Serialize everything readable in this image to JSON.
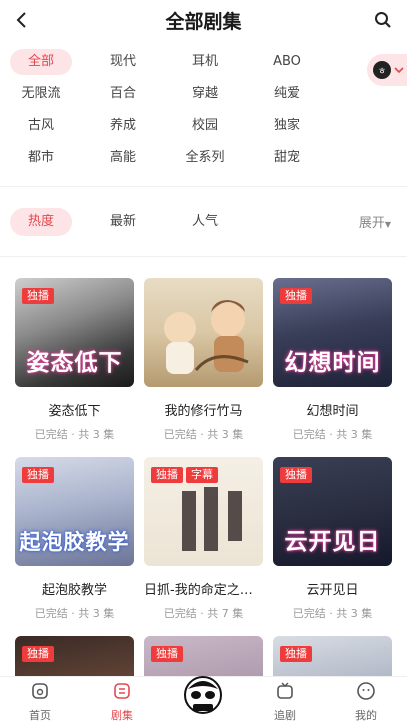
{
  "header": {
    "title": "全部剧集",
    "back_icon": "chevron-left-icon",
    "search_icon": "search-icon"
  },
  "tags": {
    "rows": [
      [
        "全部",
        "现代",
        "耳机",
        "ABO"
      ],
      [
        "无限流",
        "百合",
        "穿越",
        "纯爱"
      ],
      [
        "古风",
        "养成",
        "校园",
        "独家"
      ],
      [
        "都市",
        "高能",
        "全系列",
        "甜宠"
      ]
    ],
    "active": "全部"
  },
  "float_pill": {
    "avatar_text": "ㅎ"
  },
  "sort": {
    "items": [
      "热度",
      "最新",
      "人气"
    ],
    "active": "热度",
    "expand_label": "展开"
  },
  "cards": [
    {
      "title": "姿态低下",
      "meta": "已完结 · 共 3 集",
      "badges": [
        "独播"
      ],
      "cover_text": "姿态低下"
    },
    {
      "title": "我的修行竹马",
      "meta": "已完结 · 共 3 集",
      "badges": [],
      "cover_text": ""
    },
    {
      "title": "幻想时间",
      "meta": "已完结 · 共 3 集",
      "badges": [
        "独播"
      ],
      "cover_text": "幻想时间"
    },
    {
      "title": "起泡胶教学",
      "meta": "已完结 · 共 3 集",
      "badges": [
        "独播"
      ],
      "cover_text": "起泡胶教学"
    },
    {
      "title": "日抓-我的命定之人是高贵Ω",
      "meta": "已完结 · 共 7 集",
      "badges": [
        "独播",
        "字幕"
      ],
      "cover_text": ""
    },
    {
      "title": "云开见日",
      "meta": "已完结 · 共 3 集",
      "badges": [
        "独播"
      ],
      "cover_text": "云开见日"
    },
    {
      "title": "",
      "meta": "",
      "badges": [
        "独播"
      ],
      "cover_text": ""
    },
    {
      "title": "",
      "meta": "",
      "badges": [
        "独播"
      ],
      "cover_text": ""
    },
    {
      "title": "",
      "meta": "",
      "badges": [
        "独播"
      ],
      "cover_text": ""
    }
  ],
  "nav": [
    {
      "label": "首页",
      "icon": "home-icon"
    },
    {
      "label": "剧集",
      "icon": "drama-icon"
    },
    {
      "label": "",
      "icon": "mascot-icon"
    },
    {
      "label": "追剧",
      "icon": "tv-icon"
    },
    {
      "label": "我的",
      "icon": "profile-icon"
    }
  ],
  "colors": {
    "accent": "#e5474f",
    "accent_bg": "#fde4e6",
    "badge": "#ee3b3b"
  }
}
